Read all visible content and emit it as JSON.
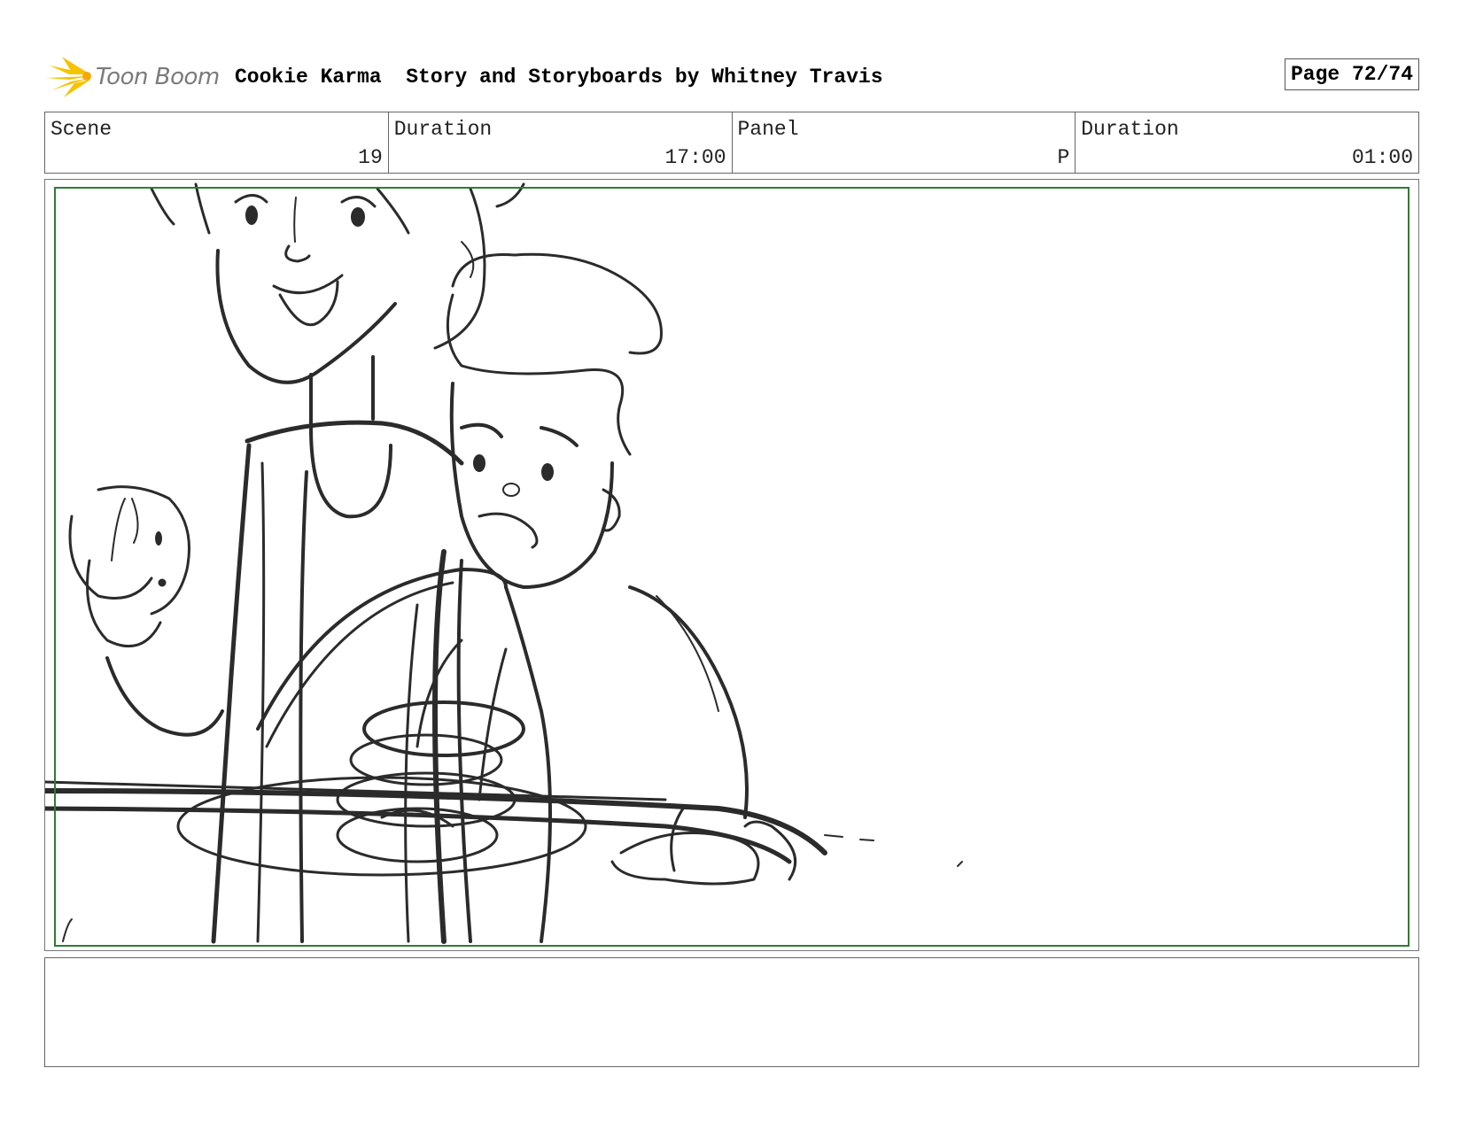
{
  "header": {
    "logo_text": "Toon Boom",
    "title": "Cookie Karma  Story and Storyboards by Whitney Travis",
    "page": "Page 72/74"
  },
  "info": {
    "scene_label": "Scene",
    "scene_value": "19",
    "scene_duration_label": "Duration",
    "scene_duration_value": "17:00",
    "panel_label": "Panel",
    "panel_value": "P",
    "panel_duration_label": "Duration",
    "panel_duration_value": "01:00"
  },
  "colors": {
    "frame": "#2e7d32",
    "logo_star": "#f5c400",
    "sketch": "#2b2b2b"
  },
  "panel": {
    "image": "rough storyboard sketch of two characters at a table"
  },
  "notes": {
    "text": ""
  }
}
